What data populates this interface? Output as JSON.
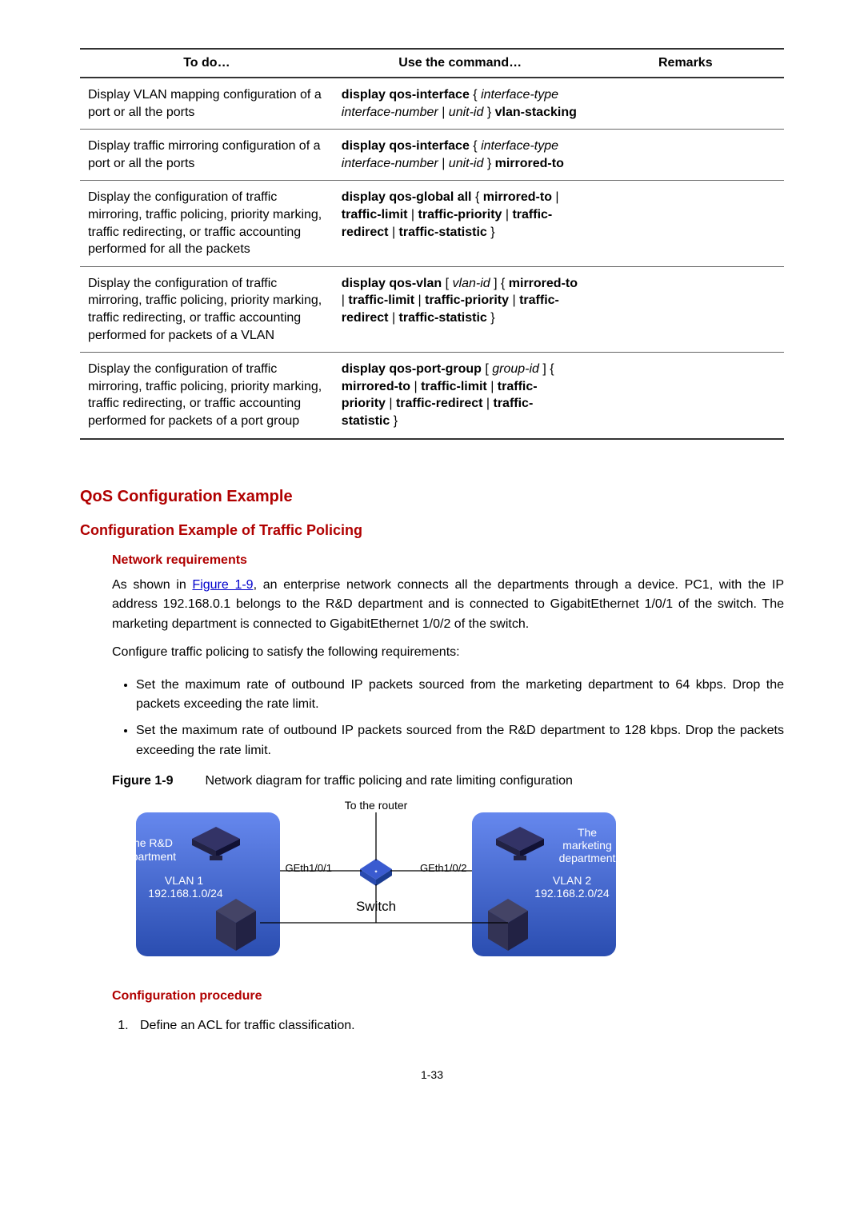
{
  "table": {
    "headers": [
      "To do…",
      "Use the command…",
      "Remarks"
    ],
    "rows": [
      {
        "desc": "Display VLAN mapping configuration of a port or all the ports",
        "cmd": "display qos-interface { interface-type interface-number | unit-id } vlan-stacking",
        "remarks": ""
      },
      {
        "desc": "Display traffic mirroring configuration of a port or all the ports",
        "cmd": "display qos-interface { interface-type interface-number | unit-id } mirrored-to",
        "remarks": ""
      },
      {
        "desc": "Display the configuration of traffic mirroring, traffic policing, priority marking, traffic redirecting, or traffic accounting performed for all the packets",
        "cmd": "display qos-global all { mirrored-to | traffic-limit | traffic-priority | traffic-redirect | traffic-statistic }",
        "remarks": ""
      },
      {
        "desc": "Display the configuration of traffic mirroring, traffic policing, priority marking, traffic redirecting, or traffic accounting performed for packets of a VLAN",
        "cmd": "display qos-vlan [ vlan-id ] { mirrored-to | traffic-limit | traffic-priority | traffic-redirect | traffic-statistic }",
        "remarks": ""
      },
      {
        "desc": "Display the configuration of traffic mirroring, traffic policing, priority marking, traffic redirecting, or traffic accounting performed for packets of a port group",
        "cmd": "display qos-port-group [ group-id ] { mirrored-to | traffic-limit | traffic-priority | traffic-redirect | traffic-statistic }",
        "remarks": ""
      }
    ]
  },
  "headings": {
    "h1": "QoS Configuration Example",
    "h2": "Configuration Example of Traffic Policing",
    "h3_req": "Network requirements",
    "h3_proc": "Configuration procedure"
  },
  "para1_pre": "As shown in ",
  "para1_link": "Figure 1-9",
  "para1_post": ", an enterprise network connects all the departments through a device. PC1, with the IP address 192.168.0.1 belongs to the R&D department and is connected to GigabitEthernet 1/0/1 of the switch. The marketing department is connected to GigabitEthernet 1/0/2 of the switch.",
  "para2": "Configure traffic policing to satisfy the following requirements:",
  "bullets": [
    "Set the maximum rate of outbound IP packets sourced from the marketing department to 64 kbps. Drop the packets exceeding the rate limit.",
    "Set the maximum rate of outbound IP packets sourced from the R&D department to 128 kbps. Drop the packets exceeding the rate limit."
  ],
  "figure": {
    "label": "Figure 1-9",
    "caption": "Network diagram for traffic policing and rate limiting configuration",
    "top_label": "To the router",
    "left_box": {
      "line1": "The R&D",
      "line2": "department",
      "line3": "VLAN 1",
      "line4": "192.168.1.0/24"
    },
    "right_box": {
      "line1": "The",
      "line2": "marketing",
      "line3": "department",
      "line4": "VLAN 2",
      "line5": "192.168.2.0/24"
    },
    "port_left": "GEth1/0/1",
    "port_right": "GEth1/0/2",
    "switch_label": "Switch"
  },
  "steps": [
    "Define an ACL for traffic classification."
  ],
  "page_number": "1-33"
}
